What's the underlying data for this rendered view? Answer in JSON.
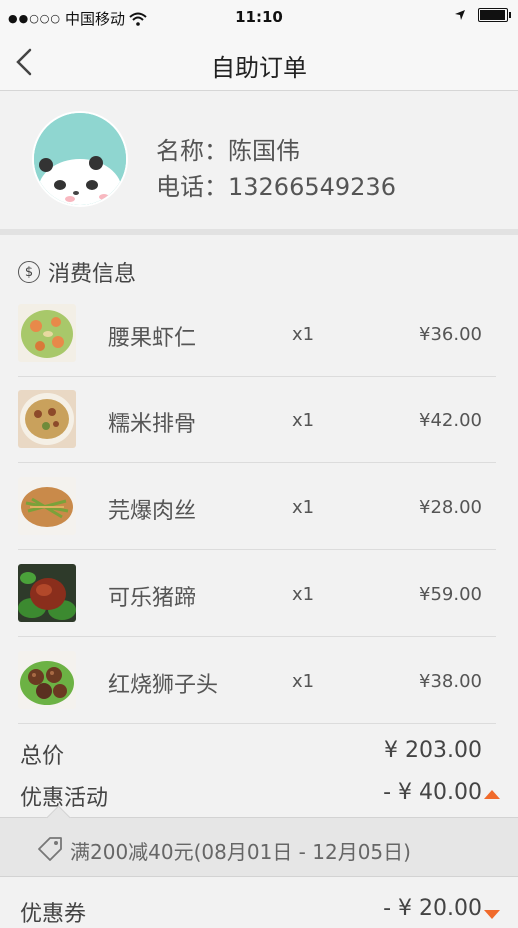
{
  "status_bar": {
    "signal": "●●○○○",
    "carrier": "中国移动",
    "time": "11:10"
  },
  "nav": {
    "title": "自助订单"
  },
  "profile": {
    "name": "名称：陈国伟",
    "phone": "电话：13266549236"
  },
  "section": {
    "title": "消费信息",
    "icon": "$"
  },
  "items": [
    {
      "name": "腰果虾仁",
      "qty": "x1",
      "price": "¥36.00"
    },
    {
      "name": "糯米排骨",
      "qty": "x1",
      "price": "¥42.00"
    },
    {
      "name": "芫爆肉丝",
      "qty": "x1",
      "price": "¥28.00"
    },
    {
      "name": "可乐猪蹄",
      "qty": "x1",
      "price": "¥59.00"
    },
    {
      "name": "红烧狮子头",
      "qty": "x1",
      "price": "¥38.00"
    }
  ],
  "summary": {
    "total_label": "总价",
    "total_value": "¥ 203.00",
    "discount_label": "优惠活动",
    "discount_value": "- ¥ 40.00",
    "promo_text": "满200减40元(08月01日 - 12月05日)",
    "coupon_label": "优惠券",
    "coupon_value": "- ¥ 20.00"
  },
  "colors": {
    "accent": "#f06a2b",
    "avatar_bg": "#8fd6d0"
  }
}
